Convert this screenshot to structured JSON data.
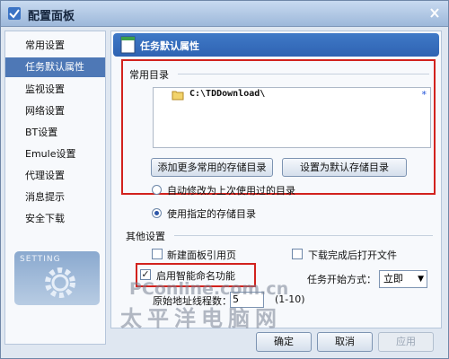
{
  "window": {
    "title": "配置面板",
    "close_icon": "close-icon"
  },
  "sidebar": {
    "items": [
      {
        "label": "常用设置"
      },
      {
        "label": "任务默认属性"
      },
      {
        "label": "监视设置"
      },
      {
        "label": "网络设置"
      },
      {
        "label": "BT设置"
      },
      {
        "label": "Emule设置"
      },
      {
        "label": "代理设置"
      },
      {
        "label": "消息提示"
      },
      {
        "label": "安全下载"
      }
    ],
    "active_index": 1,
    "setting_image_text": "SETTING"
  },
  "panel": {
    "title": "任务默认属性",
    "common_dir": {
      "label": "常用目录",
      "path": "C:\\TDDownload\\",
      "marker": "*",
      "add_button": "添加更多常用的存储目录",
      "default_button": "设置为默认存储目录"
    },
    "radio_auto": "自动修改为上次使用过的目录",
    "radio_specified": "使用指定的存储目录",
    "other": {
      "label": "其他设置",
      "new_panel_ref": "新建面板引用页",
      "open_after_done": "下载完成后打开文件",
      "smart_naming": "启用智能命名功能",
      "smart_naming_checked": "✓",
      "task_start_label": "任务开始方式：",
      "task_start_value": "立即",
      "threads_label": "原始地址线程数：",
      "threads_value": "5",
      "threads_range": "(1-10)"
    }
  },
  "watermark": {
    "line1": "PConline.com.cn",
    "line2": "太平洋电脑网"
  },
  "footer": {
    "ok": "确定",
    "cancel": "取消",
    "apply": "应用"
  },
  "colors": {
    "accent": "#2f63b2",
    "highlight": "#d2221d"
  }
}
